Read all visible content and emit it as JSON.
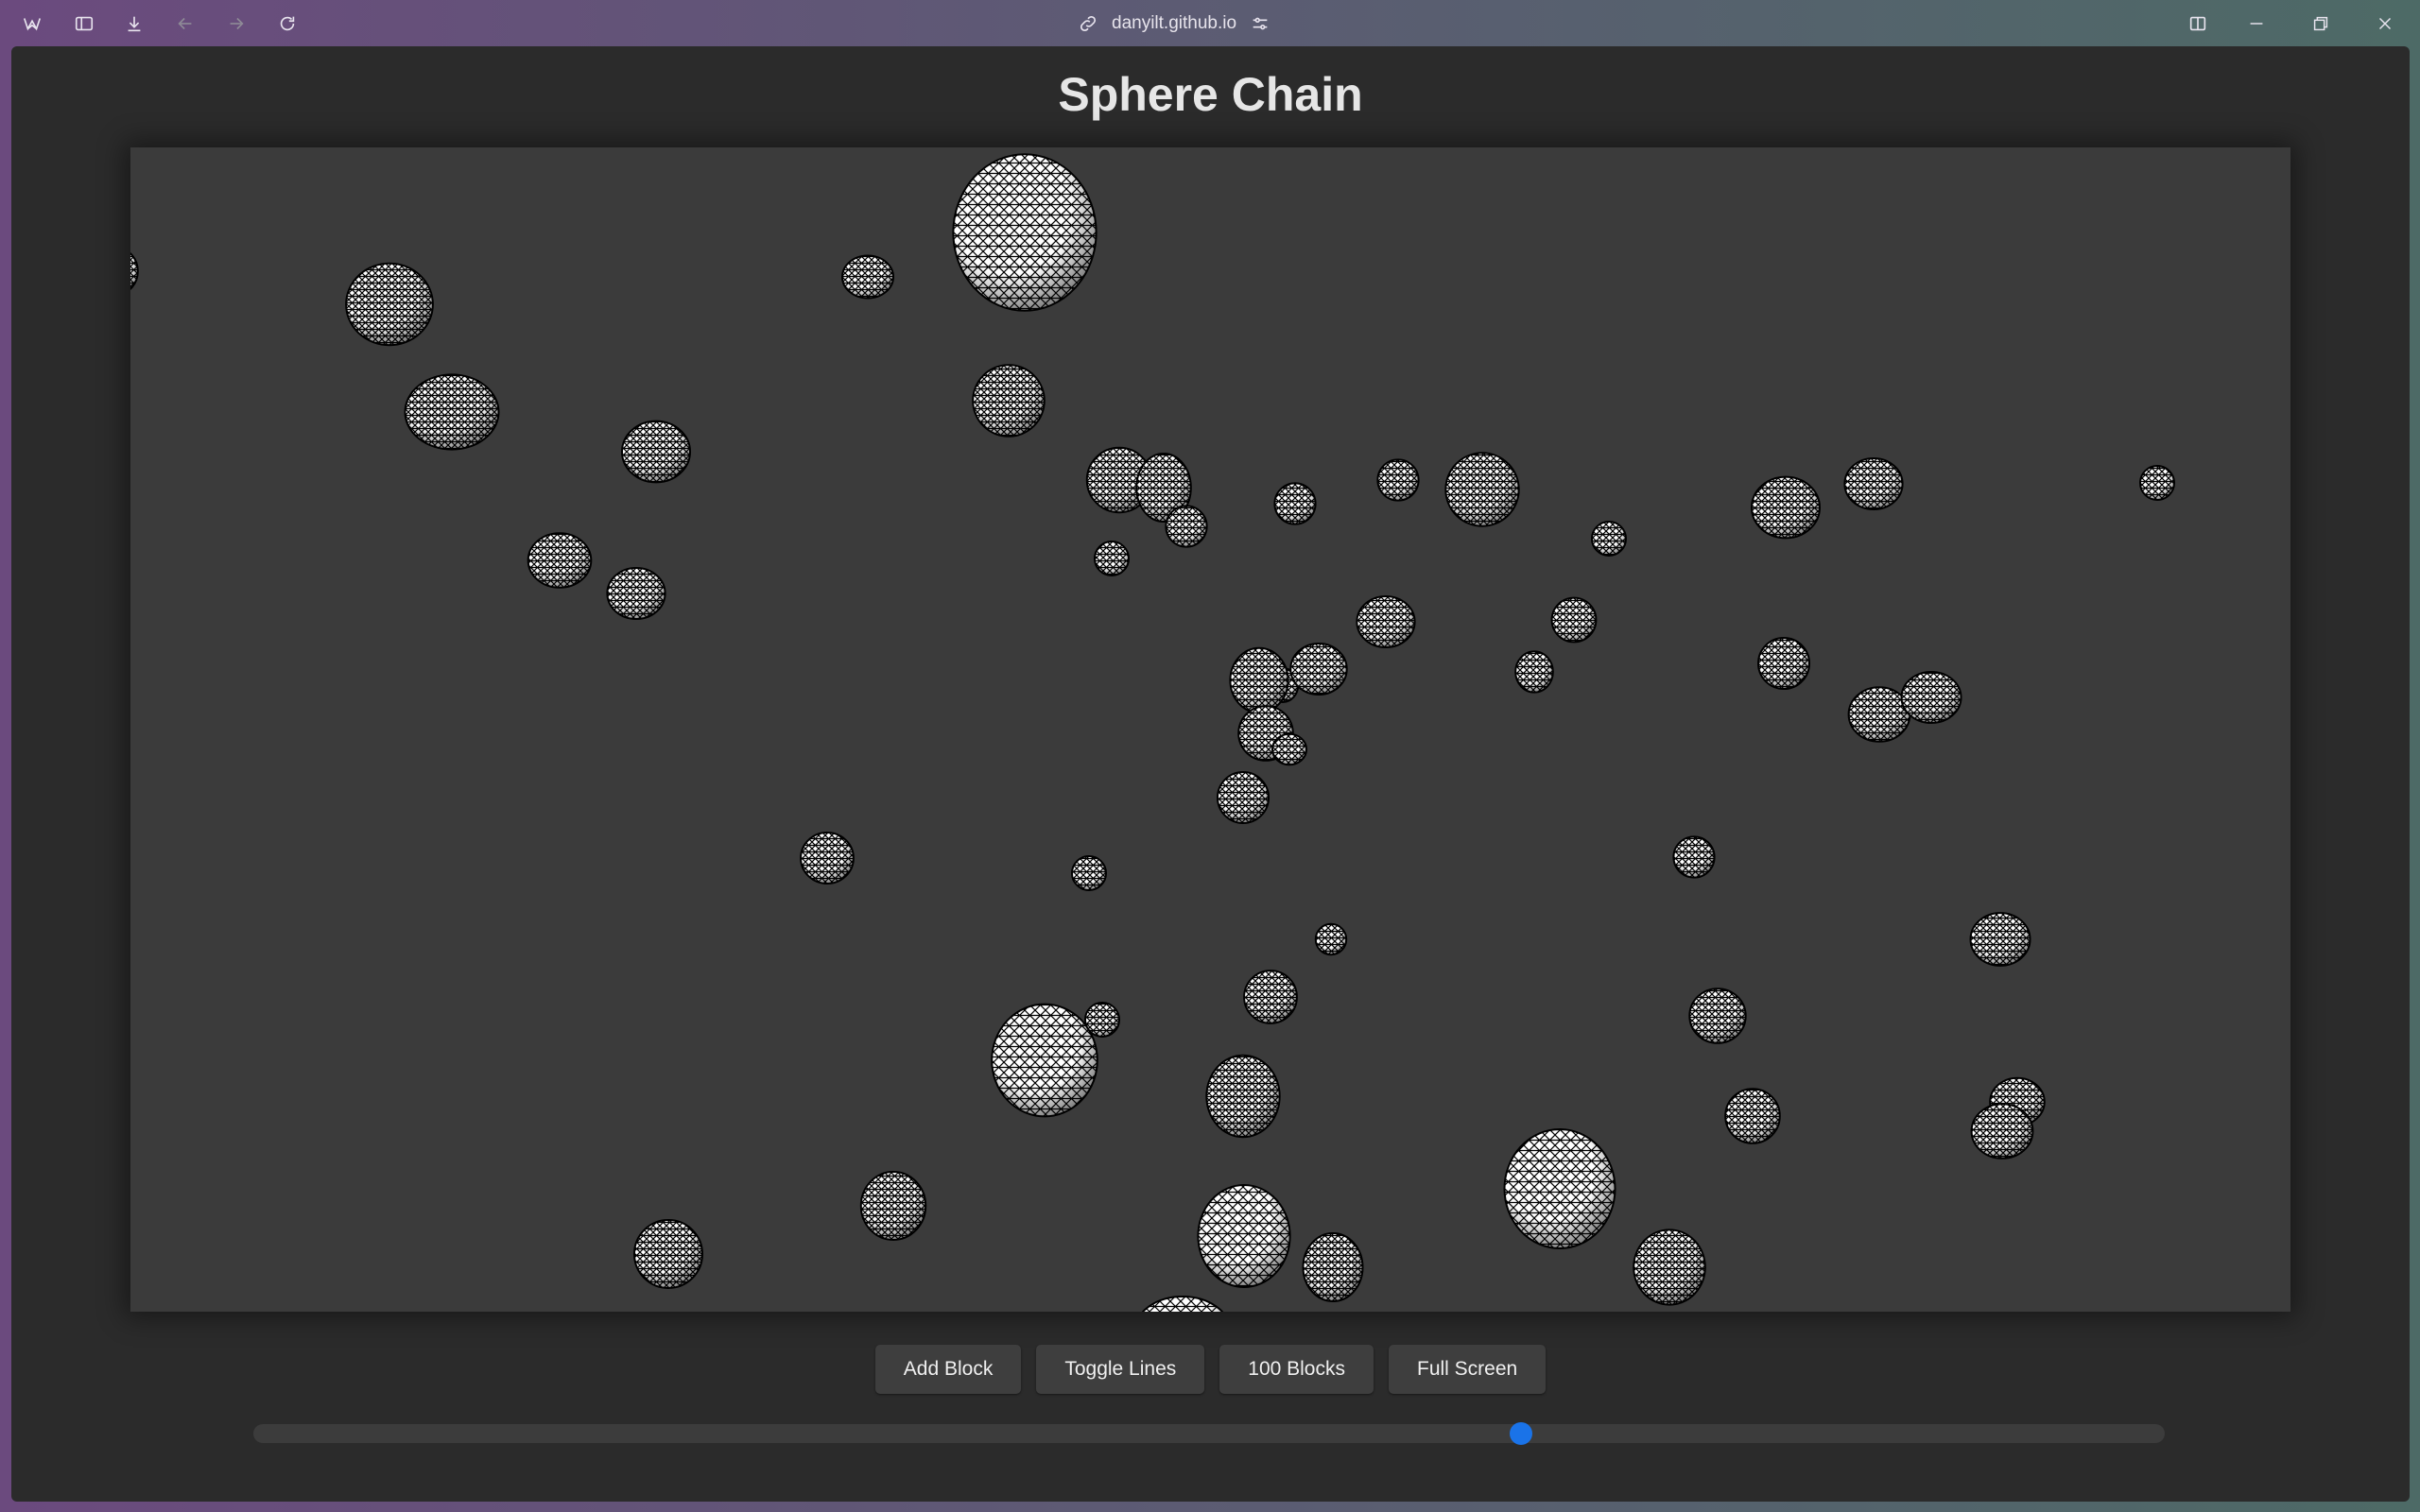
{
  "browser": {
    "url": "danyilt.github.io",
    "icons": [
      "app-logo-icon",
      "sidebar-icon",
      "download-icon",
      "back-arrow-icon",
      "forward-arrow-icon",
      "reload-icon",
      "link-icon",
      "site-settings-icon",
      "split-view-icon",
      "minimize-icon",
      "restore-icon",
      "close-icon"
    ]
  },
  "page": {
    "title": "Sphere Chain",
    "buttons": {
      "add_block": "Add Block",
      "toggle_lines": "Toggle Lines",
      "blocks_100": "100 Blocks",
      "full_screen": "Full Screen"
    },
    "slider_value": 0.663
  },
  "colors": {
    "page_bg": "#2b2b2b",
    "canvas_bg": "#3b3b3b",
    "button_bg": "#3e3e3e",
    "accent": "#1a73e8",
    "sphere_fill": "#ffffff",
    "sphere_wire": "#000000"
  }
}
